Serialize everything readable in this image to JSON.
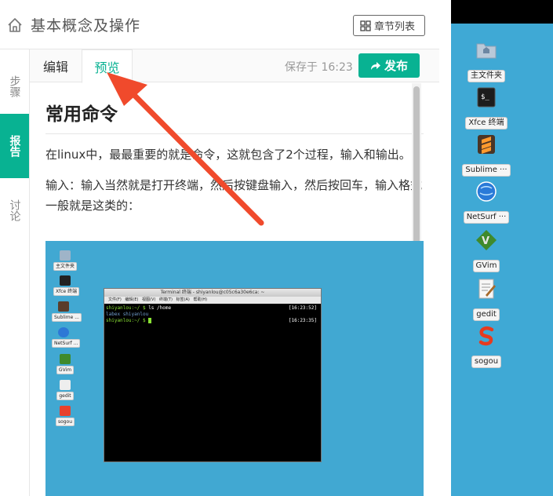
{
  "header": {
    "title": "基本概念及操作",
    "chapter_list_label": "章节列表"
  },
  "siderail": {
    "items": [
      {
        "label": "步骤",
        "active": false
      },
      {
        "label": "报告",
        "active": true
      },
      {
        "label": "讨论",
        "active": false
      }
    ]
  },
  "tabs": {
    "edit_label": "编辑",
    "preview_label": "预览",
    "active": "预览"
  },
  "toolbar": {
    "saved_text": "保存于 16:23",
    "publish_label": "发布"
  },
  "doc": {
    "heading": "常用命令",
    "para1": "在linux中，最最重要的就是命令，这就包含了2个过程，输入和输出。",
    "para2": "输入：输入当然就是打开终端，然后按键盘输入，然后按回车，输入格式一般就是这类的："
  },
  "screenshot": {
    "icons": [
      "主文件夹",
      "Xfce 终端",
      "Sublime ...",
      "NetSurf ...",
      "GVim",
      "gedit",
      "sogou"
    ],
    "terminal": {
      "title": "Terminal 终端 - shiyanlou@c05c6a30e6ca: ~",
      "menu": [
        "文件(F)",
        "编辑(E)",
        "视图(V)",
        "终端(T)",
        "标签(A)",
        "帮助(H)"
      ],
      "lines": [
        {
          "prompt": "shiyanlou:~/ $",
          "cmd": " ls /home",
          "time": "[16:23:52]"
        },
        {
          "output_a": "labex",
          "output_b": "shiyanlou"
        },
        {
          "prompt": "shiyanlou:~/ $",
          "cmd": "",
          "time": "[16:23:35]"
        }
      ]
    }
  },
  "desktop": {
    "icons": [
      {
        "label": "主文件夹",
        "icon": "folder-icon"
      },
      {
        "label": "Xfce 终端",
        "icon": "terminal-icon"
      },
      {
        "label": "Sublime ···",
        "icon": "sublime-icon"
      },
      {
        "label": "NetSurf ···",
        "icon": "netsurf-icon"
      },
      {
        "label": "GVim",
        "icon": "gvim-icon"
      },
      {
        "label": "gedit",
        "icon": "gedit-icon"
      },
      {
        "label": "sogou",
        "icon": "sogou-icon"
      }
    ]
  },
  "colors": {
    "accent": "#08b292",
    "desktop": "#3fa9d5",
    "annotation_arrow": "#f04a2c"
  }
}
